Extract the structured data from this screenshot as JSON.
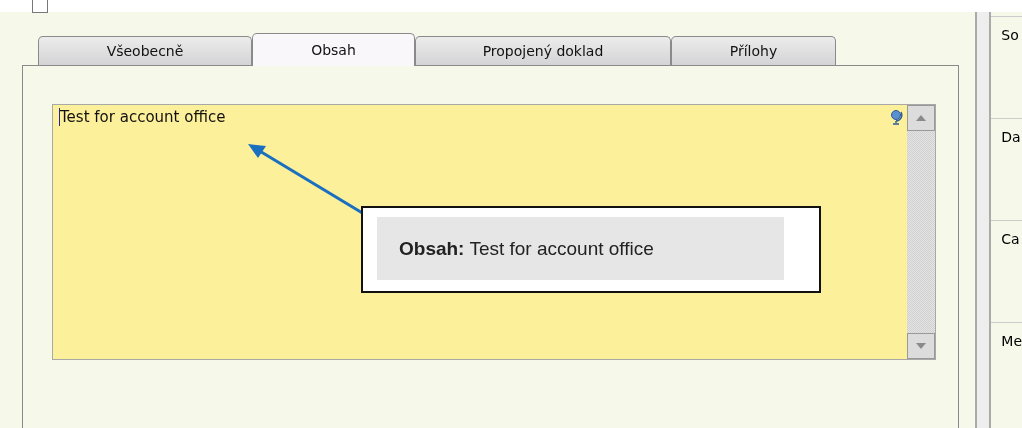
{
  "top_checkbox": {
    "checked": false
  },
  "tabs": [
    {
      "label": "Všeobecně",
      "selected": false
    },
    {
      "label": "Obsah",
      "selected": true
    },
    {
      "label": "Propojený doklad",
      "selected": false
    },
    {
      "label": "Přílohy",
      "selected": false
    }
  ],
  "content_field": {
    "value": "Test for account office"
  },
  "callout": {
    "label": "Obsah:",
    "text": "Test for account office"
  },
  "side_labels": [
    "So",
    "Da",
    "Ca",
    "Me"
  ]
}
